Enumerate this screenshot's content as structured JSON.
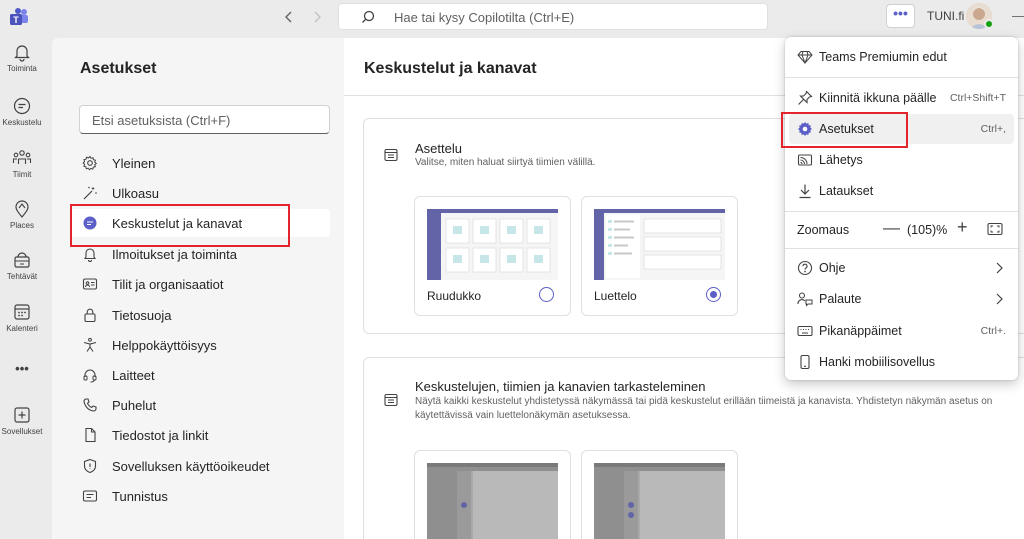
{
  "titlebar": {
    "search_placeholder": "Hae tai kysy Copilotilta (Ctrl+E)",
    "more_label": "•••",
    "org_label": "TUNI.fi",
    "back_icon": "chevron-left-icon",
    "forward_icon": "chevron-right-icon"
  },
  "rail": {
    "items": [
      {
        "label": "Toiminta",
        "icon": "bell-icon"
      },
      {
        "label": "Keskustelu",
        "icon": "chat-icon"
      },
      {
        "label": "Tiimit",
        "icon": "teams-icon"
      },
      {
        "label": "Places",
        "icon": "places-icon"
      },
      {
        "label": "Tehtävät",
        "icon": "tasks-icon"
      },
      {
        "label": "Kalenteri",
        "icon": "calendar-icon"
      },
      {
        "label": "•••",
        "icon": "more-apps-icon"
      },
      {
        "label": "Sovellukset",
        "icon": "add-apps-icon"
      }
    ]
  },
  "settings": {
    "title": "Asetukset",
    "search_placeholder": "Etsi asetuksista (Ctrl+F)",
    "items": [
      {
        "label": "Yleinen",
        "icon": "gear-icon"
      },
      {
        "label": "Ulkoasu",
        "icon": "wand-icon"
      },
      {
        "label": "Keskustelut ja kanavat",
        "icon": "chat-bubble-icon",
        "active": true
      },
      {
        "label": "Ilmoitukset ja toiminta",
        "icon": "bell-icon"
      },
      {
        "label": "Tilit ja organisaatiot",
        "icon": "id-card-icon"
      },
      {
        "label": "Tietosuoja",
        "icon": "lock-icon"
      },
      {
        "label": "Helppokäyttöisyys",
        "icon": "accessibility-icon"
      },
      {
        "label": "Laitteet",
        "icon": "headset-icon"
      },
      {
        "label": "Puhelut",
        "icon": "phone-icon"
      },
      {
        "label": "Tiedostot ja linkit",
        "icon": "document-icon"
      },
      {
        "label": "Sovelluksen käyttöoikeudet",
        "icon": "shield-icon"
      },
      {
        "label": "Tunnistus",
        "icon": "card-text-icon"
      }
    ]
  },
  "main": {
    "title": "Keskustelut ja kanavat",
    "layout_card": {
      "title": "Asettelu",
      "description": "Valitse, miten haluat siirtyä tiimien välillä.",
      "options": [
        {
          "label": "Ruudukko",
          "selected": false
        },
        {
          "label": "Luettelo",
          "selected": true
        }
      ]
    },
    "view_card": {
      "title": "Keskustelujen, tiimien ja kanavien tarkasteleminen",
      "description": "Näytä kaikki keskustelut yhdistetyssä näkymässä tai pidä keskustelut erillään tiimeistä ja kanavista. Yhdistetyn näkymän asetus on käytettävissä vain luettelonäkymän asetuksessa."
    }
  },
  "menu": {
    "items": [
      {
        "label": "Teams Premiumin edut",
        "icon": "diamond-icon",
        "shortcut": ""
      },
      {
        "label": "Kiinnitä ikkuna päälle",
        "icon": "pin-icon",
        "shortcut": "Ctrl+Shift+T"
      },
      {
        "label": "Asetukset",
        "icon": "gear-icon",
        "shortcut": "Ctrl+,"
      },
      {
        "label": "Lähetys",
        "icon": "cast-icon",
        "shortcut": ""
      },
      {
        "label": "Lataukset",
        "icon": "download-icon",
        "shortcut": ""
      },
      {
        "label": "Ohje",
        "icon": "help-icon",
        "shortcut": ""
      },
      {
        "label": "Palaute",
        "icon": "feedback-icon",
        "shortcut": ""
      },
      {
        "label": "Pikanäppäimet",
        "icon": "keyboard-icon",
        "shortcut": "Ctrl+."
      },
      {
        "label": "Hanki mobiilisovellus",
        "icon": "phone-mobile-icon",
        "shortcut": ""
      }
    ],
    "zoom": {
      "label": "Zoomaus",
      "minus": "—",
      "value": "(105)%",
      "plus": "+"
    }
  },
  "colors": {
    "accent": "#5b5fc7",
    "highlight_box": "#e3242b",
    "presence": "#13a10e"
  }
}
